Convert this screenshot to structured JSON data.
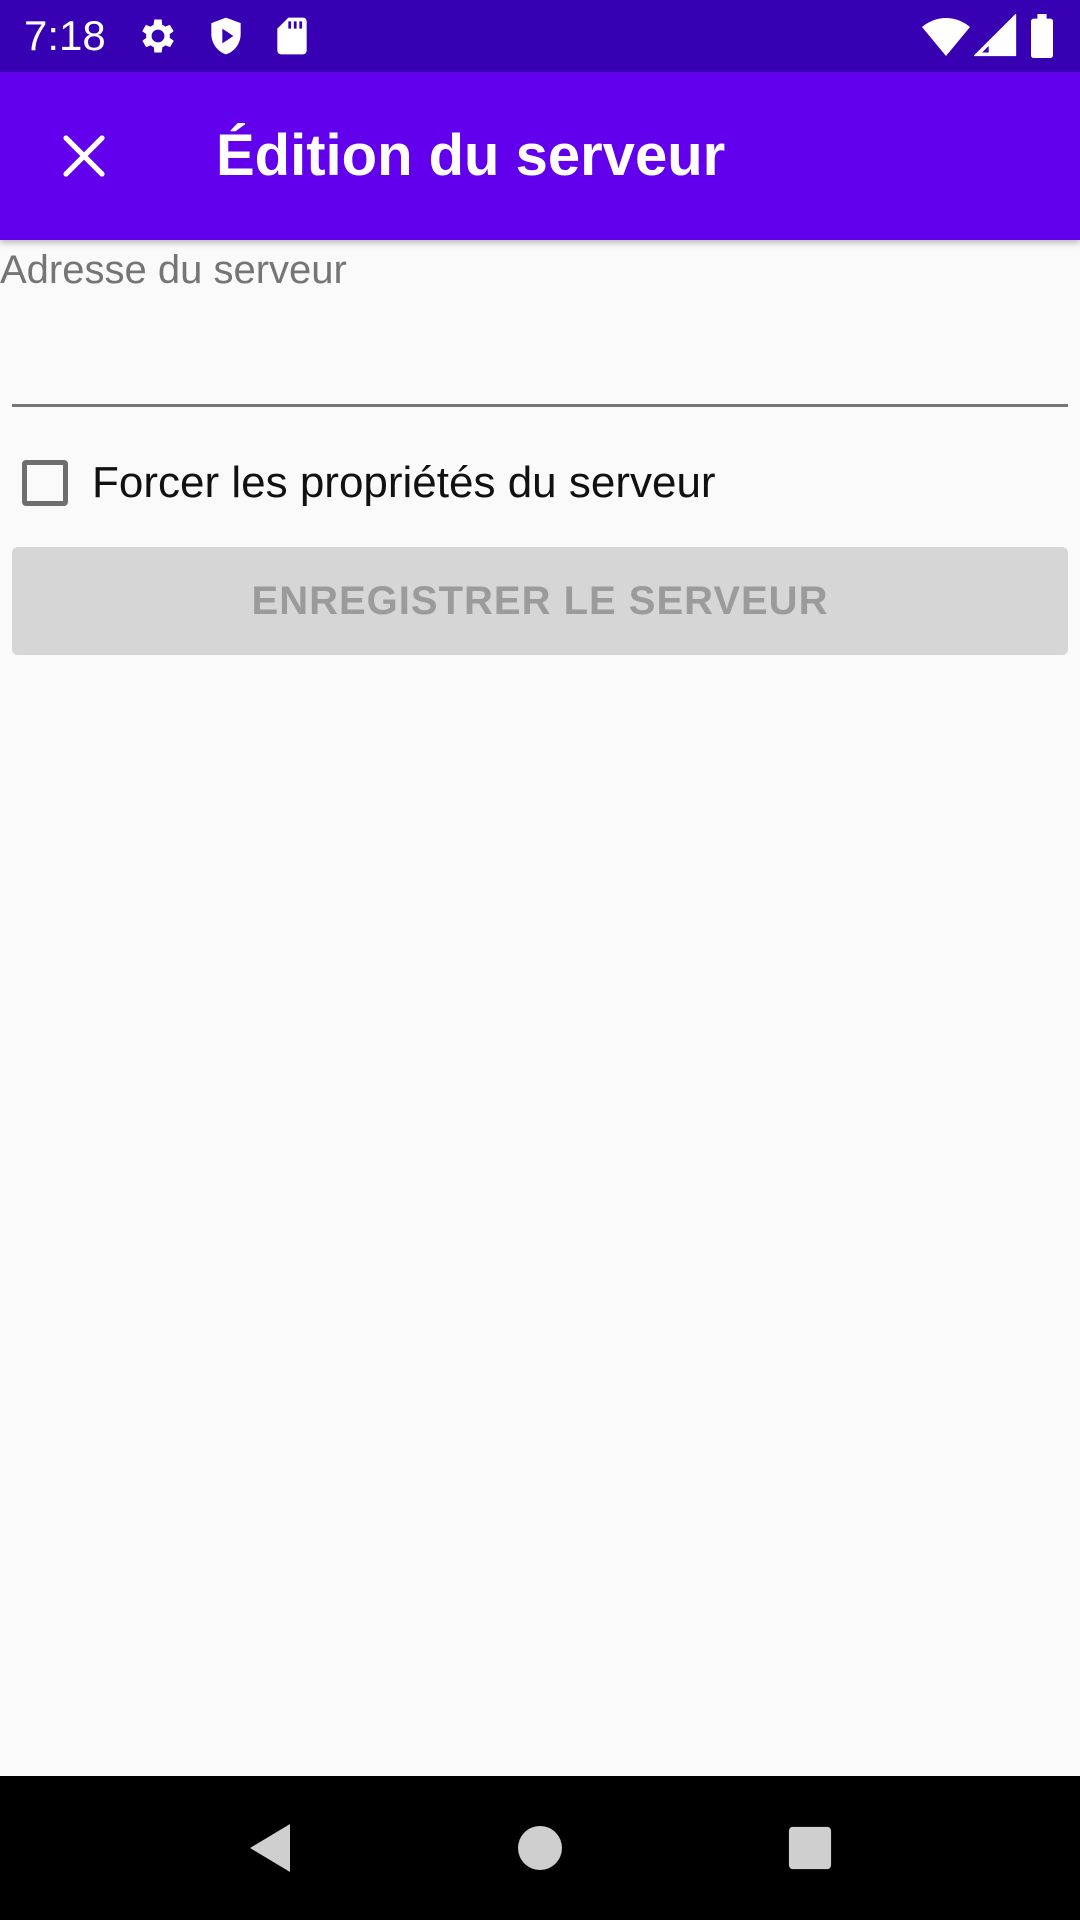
{
  "status_bar": {
    "time": "7:18",
    "icons_left": [
      "settings-icon",
      "shield-play-icon",
      "sd-card-icon"
    ],
    "icons_right": [
      "wifi-icon",
      "cell-signal-icon",
      "battery-icon"
    ]
  },
  "app_bar": {
    "title": "Édition du serveur",
    "close_icon": "close-icon",
    "background": "#6200ee"
  },
  "form": {
    "address_label": "Adresse du serveur",
    "address_value": "",
    "force_checkbox_label": "Forcer les propriétés du serveur",
    "force_checked": false,
    "save_button_label": "ENREGISTRER LE SERVEUR",
    "save_button_enabled": false
  },
  "nav_bar": {
    "back": "back-triangle-icon",
    "home": "home-circle-icon",
    "recents": "recents-square-icon"
  },
  "colors": {
    "status_bar": "#3700b3",
    "primary": "#6200ee",
    "background": "#fafafa",
    "disabled_button": "#d6d6d6"
  }
}
